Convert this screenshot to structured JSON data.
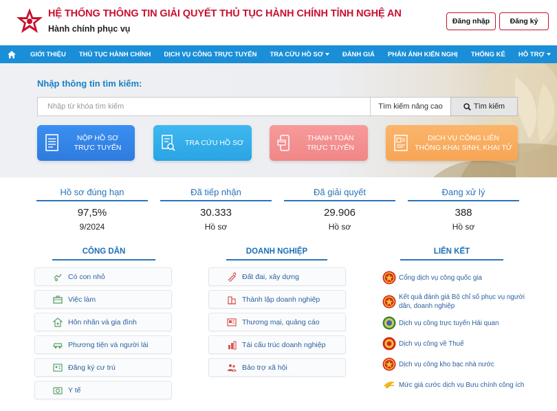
{
  "header": {
    "title": "HỆ THỐNG THÔNG TIN GIẢI QUYẾT THỦ TỤC HÀNH CHÍNH TỈNH NGHỆ AN",
    "subtitle": "Hành chính phục vụ",
    "login_label": "Đăng nhập",
    "register_label": "Đăng ký",
    "brand_color": "#c8102e"
  },
  "nav": {
    "home_icon": "home-icon",
    "items": [
      {
        "label": "GIỚI THIỆU"
      },
      {
        "label": "THỦ TỤC HÀNH CHÍNH"
      },
      {
        "label": "DỊCH VỤ CÔNG TRỰC TUYẾN"
      },
      {
        "label": "TRA CỨU HỒ SƠ"
      },
      {
        "label": "ĐÁNH GIÁ"
      },
      {
        "label": "PHẢN ÁNH KIẾN NGHỊ"
      },
      {
        "label": "THỐNG KÊ"
      },
      {
        "label": "HỖ TRỢ"
      }
    ],
    "color": "#1a8fd8"
  },
  "search": {
    "label": "Nhập thông tin tìm kiếm:",
    "placeholder": "Nhập từ khóa tìm kiếm",
    "advanced_label": "Tìm kiếm nâng cao",
    "button_label": "Tìm kiếm"
  },
  "quick_actions": [
    {
      "label": "NỘP HỒ SƠ TRỰC TUYẾN",
      "icon": "document-icon",
      "color": "#3a8ff0"
    },
    {
      "label": "TRA CỨU HỒ SƠ",
      "icon": "search-document-icon",
      "color": "#3fb8f0"
    },
    {
      "label": "THANH TOÁN TRỰC TUYẾN",
      "icon": "mobile-payment-icon",
      "color": "#f79a9a"
    },
    {
      "label": "DỊCH VỤ CÔNG LIÊN THÔNG KHAI SINH, KHAI TỬ",
      "icon": "certificate-icon",
      "color": "#fbb56a"
    }
  ],
  "stats": [
    {
      "label": "Hồ sơ đúng hạn",
      "value": "97,5%",
      "sub": "9/2024"
    },
    {
      "label": "Đã tiếp nhận",
      "value": "30.333",
      "sub": "Hồ sơ"
    },
    {
      "label": "Đã giải quyết",
      "value": "29.906",
      "sub": "Hồ sơ"
    },
    {
      "label": "Đang xử lý",
      "value": "388",
      "sub": "Hồ sơ"
    }
  ],
  "citizen": {
    "title": "CÔNG DÂN",
    "items": [
      {
        "label": "Có con nhỏ",
        "icon": "baby-icon"
      },
      {
        "label": "Việc làm",
        "icon": "briefcase-icon"
      },
      {
        "label": "Hôn nhân và gia đình",
        "icon": "family-icon"
      },
      {
        "label": "Phương tiện và người lái",
        "icon": "car-icon"
      },
      {
        "label": "Đăng ký cư trú",
        "icon": "residence-icon"
      },
      {
        "label": "Y tế",
        "icon": "health-icon"
      }
    ]
  },
  "business": {
    "title": "DOANH NGHIỆP",
    "items": [
      {
        "label": "Đất đai, xây dựng",
        "icon": "construction-icon"
      },
      {
        "label": "Thành lập doanh nghiệp",
        "icon": "company-icon"
      },
      {
        "label": "Thương mại, quảng cáo",
        "icon": "advertising-icon"
      },
      {
        "label": "Tái cấu trúc doanh nghiệp",
        "icon": "restructure-icon"
      },
      {
        "label": "Bảo trợ xã hội",
        "icon": "social-support-icon"
      }
    ]
  },
  "links": {
    "title": "LIÊN KẾT",
    "items": [
      {
        "label": "Cổng dịch vụ công quốc gia",
        "icon": "national-emblem-icon"
      },
      {
        "label": "Kết quả đánh giá Bộ chỉ số phục vụ người dân, doanh nghiệp",
        "icon": "national-emblem-icon"
      },
      {
        "label": "Dịch vụ công trực tuyến Hải quan",
        "icon": "customs-emblem-icon"
      },
      {
        "label": "Dịch vụ công về Thuế",
        "icon": "tax-emblem-icon"
      },
      {
        "label": "Dịch vụ công kho bạc nhà nước",
        "icon": "treasury-emblem-icon"
      },
      {
        "label": "Mức giá cước dịch vụ Bưu chính công ích",
        "icon": "postal-icon"
      }
    ]
  }
}
